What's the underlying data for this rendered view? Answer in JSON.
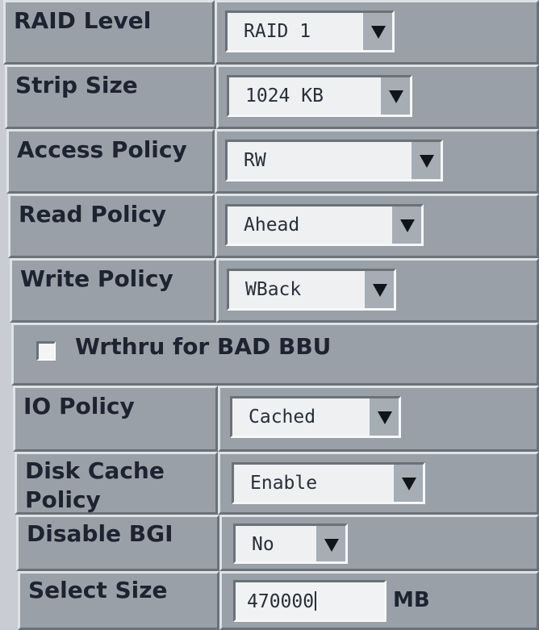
{
  "form": {
    "raid_level": {
      "label": "RAID Level",
      "value": "RAID 1"
    },
    "strip_size": {
      "label": "Strip Size",
      "value": "1024 KB"
    },
    "access_policy": {
      "label": "Access Policy",
      "value": "RW"
    },
    "read_policy": {
      "label": "Read Policy",
      "value": "Ahead"
    },
    "write_policy": {
      "label": "Write Policy",
      "value": "WBack"
    },
    "wrthru_bad_bbu": {
      "label": "Wrthru for BAD BBU",
      "checked": false
    },
    "io_policy": {
      "label": "IO Policy",
      "value": "Cached"
    },
    "disk_cache_policy": {
      "label_line1": "Disk Cache",
      "label_line2": "Policy",
      "value": "Enable"
    },
    "disable_bgi": {
      "label": "Disable BGI",
      "value": "No"
    },
    "select_size": {
      "label": "Select Size",
      "value": "470000",
      "unit": "MB"
    }
  },
  "icons": {
    "dropdown_arrow": "chevron-down-icon",
    "checkbox": "checkbox-icon"
  },
  "colors": {
    "panel": "#9aa0a7",
    "background": "#c9cdd3",
    "field": "#eef0f2",
    "text": "#1d2330"
  }
}
